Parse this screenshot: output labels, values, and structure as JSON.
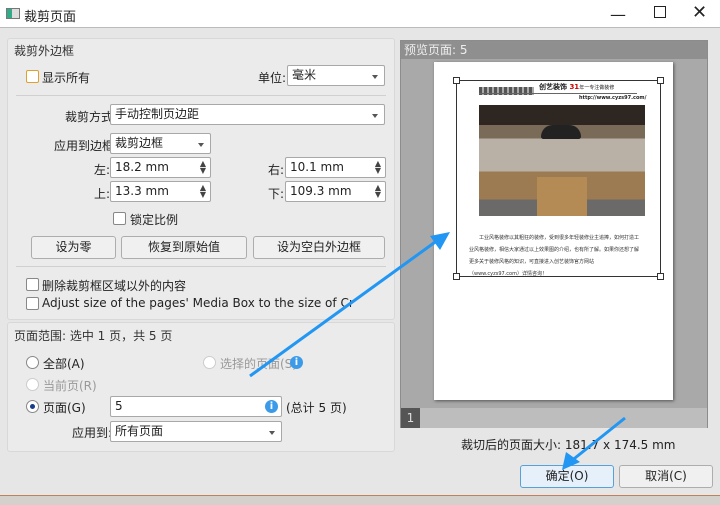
{
  "window": {
    "title": "裁剪页面",
    "icon": "app-icon"
  },
  "crop_box": {
    "header": "裁剪外边框",
    "show_all_label": "显示所有",
    "show_all_checked": false,
    "unit_label": "单位:",
    "unit_value": "毫米",
    "crop_mode_label": "裁剪方式",
    "crop_mode_value": "手动控制页边距",
    "apply_box_label": "应用到边框",
    "apply_box_value": "裁剪边框",
    "left_label": "左:",
    "left_value": "18.2 mm",
    "right_label": "右:",
    "right_value": "10.1 mm",
    "top_label": "上:",
    "top_value": "13.3 mm",
    "bottom_label": "下:",
    "bottom_value": "109.3 mm",
    "lock_ratio_label": "锁定比例",
    "lock_ratio_checked": false,
    "set_zero": "设为零",
    "restore": "恢复到原始值",
    "set_blank": "设为空白外边框",
    "delete_outside_label": "删除裁剪框区域以外的内容",
    "delete_outside_checked": false,
    "adjust_media_label": "Adjust size of the pages' Media Box to the size of Crop Box",
    "adjust_media_checked": false
  },
  "page_range": {
    "header": "页面范围: 选中 1 页，共 5 页",
    "all_label": "全部(A)",
    "selected_pages_label": "选择的页面(S)",
    "current_page_label": "当前页(R)",
    "pages_label": "页面(G)",
    "pages_value": "5",
    "total_label": "(总计 5 页)",
    "apply_to_label": "应用到:",
    "apply_to_value": "所有页面",
    "selected_option": "pages"
  },
  "preview": {
    "header": "预览页面: 5",
    "tab": "1",
    "doc_title": "创艺装饰",
    "doc_subtitle": "年一专注做装修",
    "doc_url": "http://www.cyzs97.com/",
    "doc_text": "工业风格装修以其粗狂的装修，受到很多年轻装修业主追捧，如何打造工业风格装修，相信大家通过以上效果图的介绍，也有所了解。如果你还想了解更多关于装修风格的知识，可直接进入创艺装饰官方网站（www.cyzs97.com）详情咨询！",
    "size_text": "裁切后的页面大小: 181.7 x 174.5 mm"
  },
  "footer": {
    "ok": "确定(O)",
    "cancel": "取消(C)"
  },
  "colors": {
    "accent": "#2196f3",
    "info": "#3b9be8"
  }
}
